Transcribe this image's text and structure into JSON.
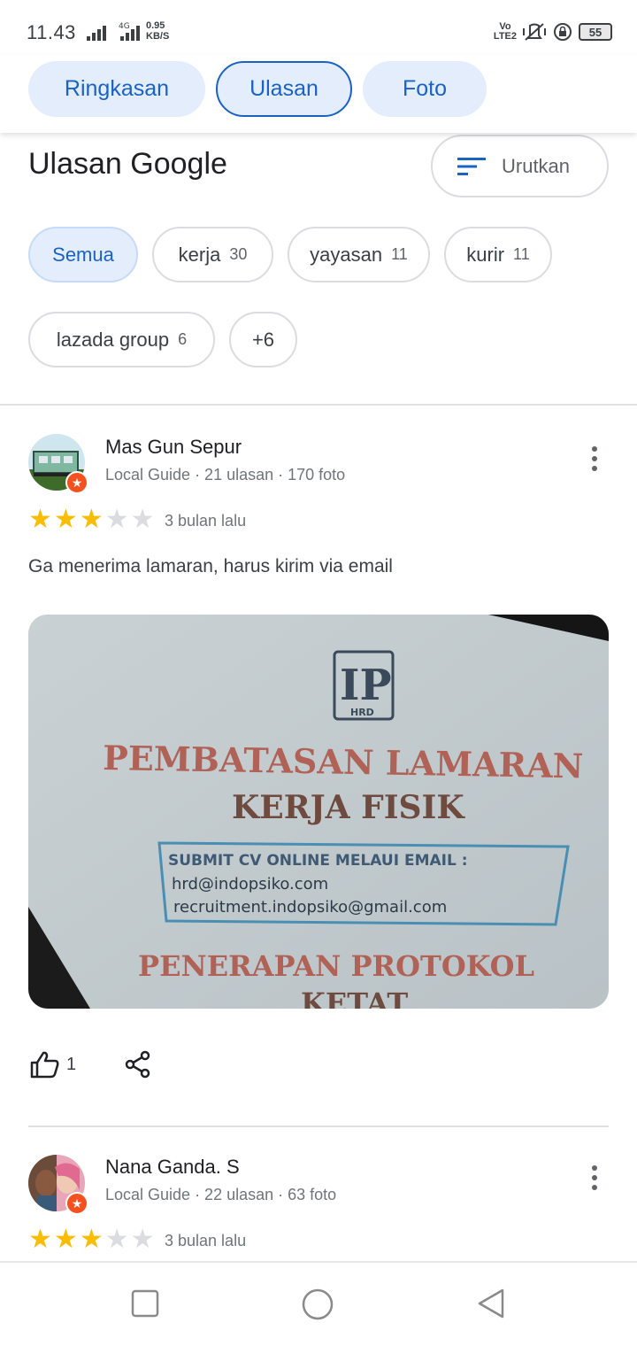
{
  "status_bar": {
    "time": "11.43",
    "net_speed_value": "0.95",
    "net_speed_unit": "KB/S",
    "network_label_1": "Vo",
    "network_label_2": "LTE2",
    "battery": "55"
  },
  "tabs": [
    {
      "label": "Ringkasan",
      "active": false
    },
    {
      "label": "Ulasan",
      "active": true
    },
    {
      "label": "Foto",
      "active": false
    }
  ],
  "section": {
    "title": "Ulasan Google",
    "sort_label": "Urutkan"
  },
  "chips": [
    {
      "label": "Semua",
      "count": ""
    },
    {
      "label": "kerja",
      "count": "30"
    },
    {
      "label": "yayasan",
      "count": "11"
    },
    {
      "label": "kurir",
      "count": "11"
    },
    {
      "label": "lazada group",
      "count": "6"
    },
    {
      "label": "+6",
      "count": ""
    }
  ],
  "reviews": [
    {
      "name": "Mas Gun Sepur",
      "meta": "Local Guide · 21 ulasan · 170 foto",
      "rating": 3,
      "max_rating": 5,
      "date": "3 bulan lalu",
      "text": "Ga menerima lamaran,  harus kirim via email",
      "photo": {
        "logo_text": "HRD",
        "line1": "PEMBATASAN LAMARAN",
        "line2": "KERJA FISIK",
        "box_title": "SUBMIT CV ONLINE MELAUI EMAIL :",
        "email1": "hrd@indopsiko.com",
        "email2": "recruitment.indopsiko@gmail.com",
        "line3": "PENERAPAN PROTOKOL",
        "line4": "KETAT"
      },
      "likes": "1"
    },
    {
      "name": "Nana Ganda. S",
      "meta": "Local Guide · 22 ulasan · 63 foto",
      "rating": 3,
      "max_rating": 5,
      "date": "3 bulan lalu"
    }
  ],
  "colors": {
    "accent": "#1a62c4",
    "chip_selected_bg": "#e3edfc",
    "star_on": "#fbbc04",
    "star_off": "#dadce0",
    "local_guide_badge": "#f4511e"
  }
}
